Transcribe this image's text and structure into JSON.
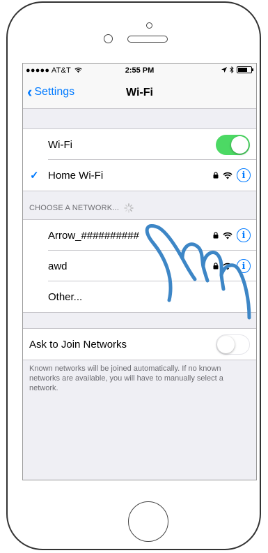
{
  "status_bar": {
    "carrier": "●●●●● AT&T",
    "time": "2:55 PM",
    "battery_level": 0.8
  },
  "nav": {
    "back_label": "Settings",
    "title": "Wi-Fi"
  },
  "wifi_section": {
    "label": "Wi-Fi",
    "enabled": true,
    "connected_network": "Home Wi-Fi"
  },
  "choose_header": "CHOOSE A NETWORK...",
  "networks": [
    {
      "name": "Arrow_##########",
      "secured": true
    },
    {
      "name": "awd",
      "secured": true
    },
    {
      "name": "Other..."
    }
  ],
  "ask_to_join": {
    "label": "Ask to Join Networks",
    "enabled": false
  },
  "footer_text": "Known networks will be joined automatically. If no known networks are available, you will have to manually select a network.",
  "colors": {
    "accent": "#007aff",
    "toggle_on": "#4cd964",
    "hand_stroke": "#3d86c6"
  }
}
